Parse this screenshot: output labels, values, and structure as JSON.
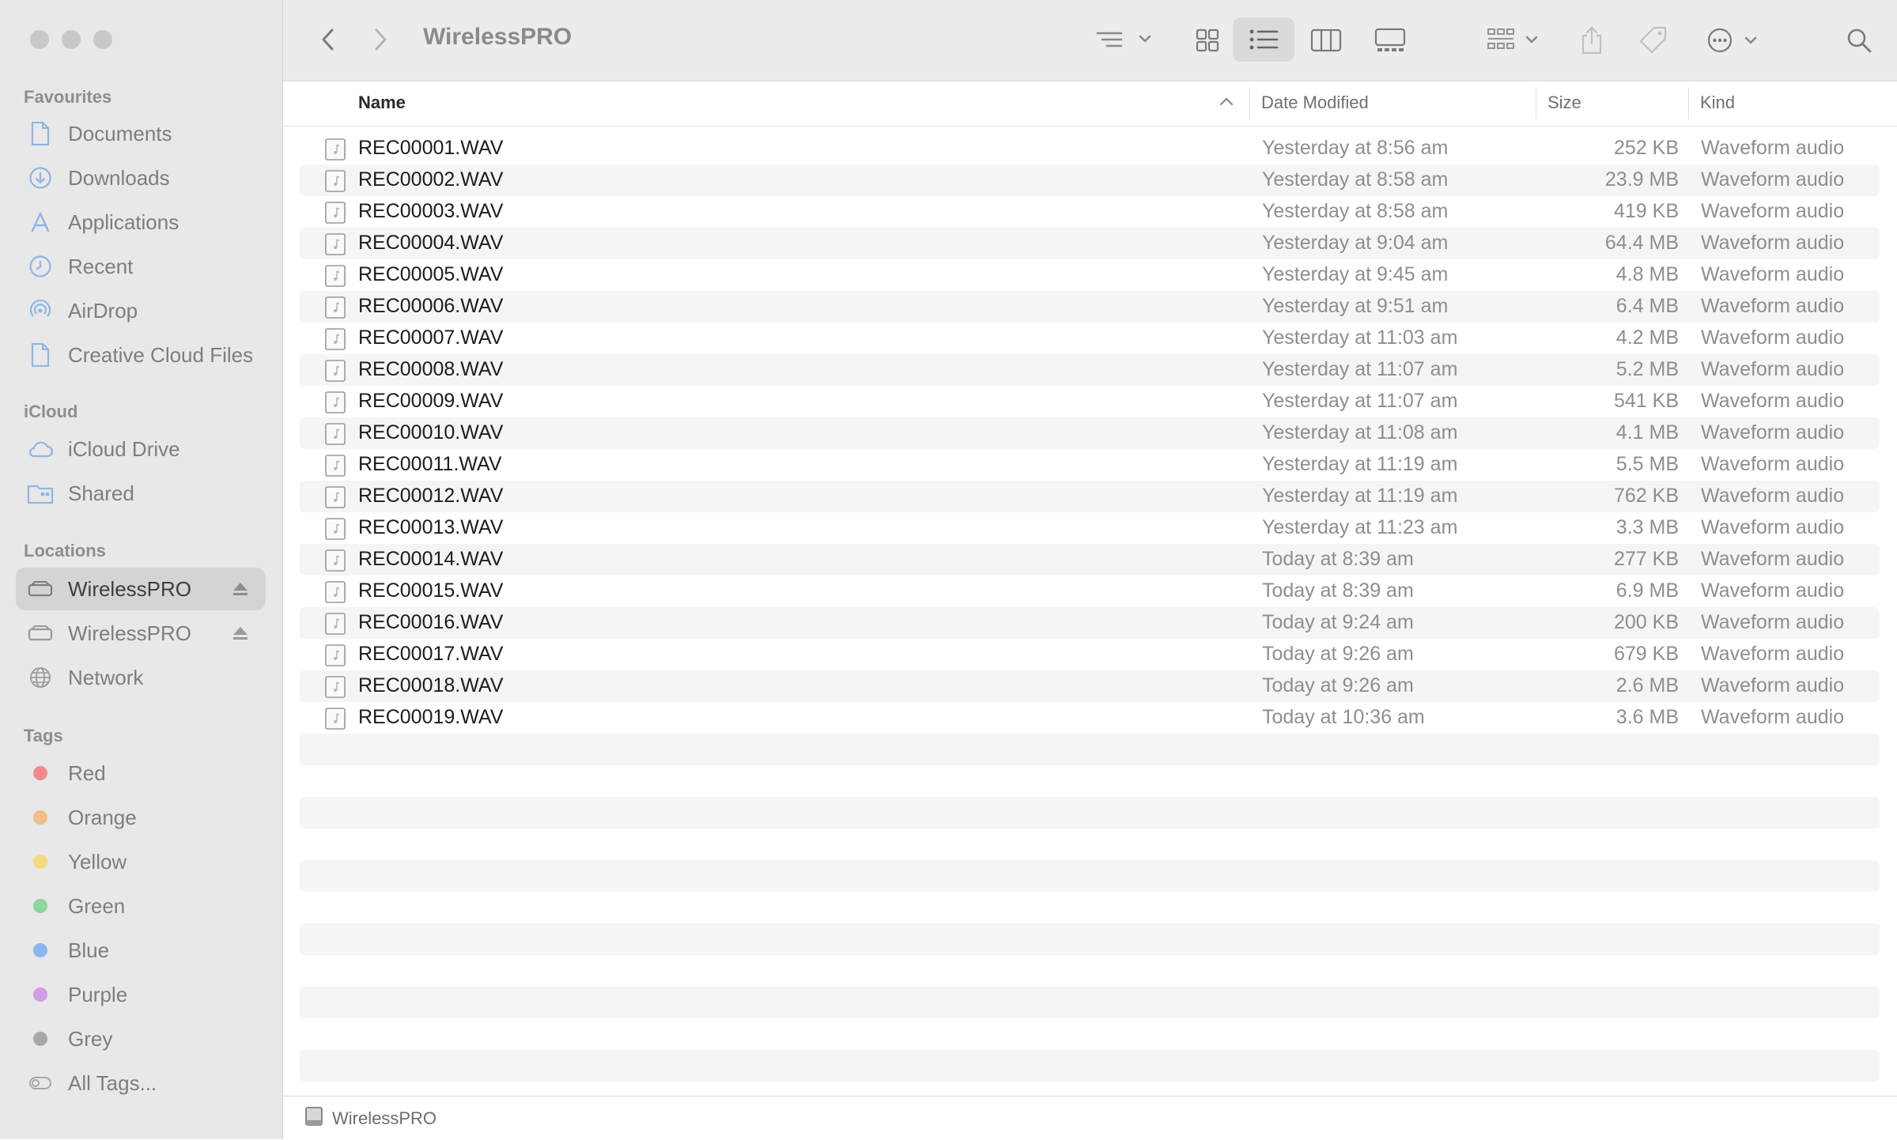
{
  "window": {
    "title": "WirelessPRO"
  },
  "sidebar": {
    "favourites_title": "Favourites",
    "favourites": [
      {
        "label": "Documents",
        "icon": "document-icon"
      },
      {
        "label": "Downloads",
        "icon": "download-icon"
      },
      {
        "label": "Applications",
        "icon": "applications-icon"
      },
      {
        "label": "Recent",
        "icon": "clock-icon"
      },
      {
        "label": "AirDrop",
        "icon": "airdrop-icon"
      },
      {
        "label": "Creative Cloud Files",
        "icon": "file-icon"
      }
    ],
    "icloud_title": "iCloud",
    "icloud": [
      {
        "label": "iCloud Drive",
        "icon": "cloud-icon"
      },
      {
        "label": "Shared",
        "icon": "shared-folder-icon"
      }
    ],
    "locations_title": "Locations",
    "locations": [
      {
        "label": "WirelessPRO",
        "icon": "drive-icon",
        "active": true
      },
      {
        "label": "WirelessPRO",
        "icon": "drive-icon",
        "active": false
      },
      {
        "label": "Network",
        "icon": "globe-icon"
      }
    ],
    "tags_title": "Tags",
    "tags": [
      {
        "label": "Red",
        "color": "#f08b8b"
      },
      {
        "label": "Orange",
        "color": "#f0be86"
      },
      {
        "label": "Yellow",
        "color": "#f0dc7a"
      },
      {
        "label": "Green",
        "color": "#8fd69b"
      },
      {
        "label": "Blue",
        "color": "#8ab6f2"
      },
      {
        "label": "Purple",
        "color": "#d49be6"
      },
      {
        "label": "Grey",
        "color": "#a8a8a8"
      }
    ],
    "all_tags": "All Tags..."
  },
  "toolbar": {
    "title": "WirelessPRO",
    "icons": [
      "back-icon",
      "forward-icon",
      "sort-options-icon",
      "icon-view-icon",
      "list-view-icon",
      "column-view-icon",
      "gallery-view-icon",
      "group-icon",
      "share-icon",
      "tag-icon",
      "more-icon",
      "search-icon"
    ]
  },
  "columns": {
    "name": "Name",
    "date": "Date Modified",
    "size": "Size",
    "kind": "Kind"
  },
  "files": [
    {
      "name": "REC00001.WAV",
      "date": "Yesterday at 8:56 am",
      "size": "252 KB",
      "kind": "Waveform audio"
    },
    {
      "name": "REC00002.WAV",
      "date": "Yesterday at 8:58 am",
      "size": "23.9 MB",
      "kind": "Waveform audio"
    },
    {
      "name": "REC00003.WAV",
      "date": "Yesterday at 8:58 am",
      "size": "419 KB",
      "kind": "Waveform audio"
    },
    {
      "name": "REC00004.WAV",
      "date": "Yesterday at 9:04 am",
      "size": "64.4 MB",
      "kind": "Waveform audio"
    },
    {
      "name": "REC00005.WAV",
      "date": "Yesterday at 9:45 am",
      "size": "4.8 MB",
      "kind": "Waveform audio"
    },
    {
      "name": "REC00006.WAV",
      "date": "Yesterday at 9:51 am",
      "size": "6.4 MB",
      "kind": "Waveform audio"
    },
    {
      "name": "REC00007.WAV",
      "date": "Yesterday at 11:03 am",
      "size": "4.2 MB",
      "kind": "Waveform audio"
    },
    {
      "name": "REC00008.WAV",
      "date": "Yesterday at 11:07 am",
      "size": "5.2 MB",
      "kind": "Waveform audio"
    },
    {
      "name": "REC00009.WAV",
      "date": "Yesterday at 11:07 am",
      "size": "541 KB",
      "kind": "Waveform audio"
    },
    {
      "name": "REC00010.WAV",
      "date": "Yesterday at 11:08 am",
      "size": "4.1 MB",
      "kind": "Waveform audio"
    },
    {
      "name": "REC00011.WAV",
      "date": "Yesterday at 11:19 am",
      "size": "5.5 MB",
      "kind": "Waveform audio"
    },
    {
      "name": "REC00012.WAV",
      "date": "Yesterday at 11:19 am",
      "size": "762 KB",
      "kind": "Waveform audio"
    },
    {
      "name": "REC00013.WAV",
      "date": "Yesterday at 11:23 am",
      "size": "3.3 MB",
      "kind": "Waveform audio"
    },
    {
      "name": "REC00014.WAV",
      "date": "Today at 8:39 am",
      "size": "277 KB",
      "kind": "Waveform audio"
    },
    {
      "name": "REC00015.WAV",
      "date": "Today at 8:39 am",
      "size": "6.9 MB",
      "kind": "Waveform audio"
    },
    {
      "name": "REC00016.WAV",
      "date": "Today at 9:24 am",
      "size": "200 KB",
      "kind": "Waveform audio"
    },
    {
      "name": "REC00017.WAV",
      "date": "Today at 9:26 am",
      "size": "679 KB",
      "kind": "Waveform audio"
    },
    {
      "name": "REC00018.WAV",
      "date": "Today at 9:26 am",
      "size": "2.6 MB",
      "kind": "Waveform audio"
    },
    {
      "name": "REC00019.WAV",
      "date": "Today at 10:36 am",
      "size": "3.6 MB",
      "kind": "Waveform audio"
    }
  ],
  "pathbar": {
    "label": "WirelessPRO"
  }
}
